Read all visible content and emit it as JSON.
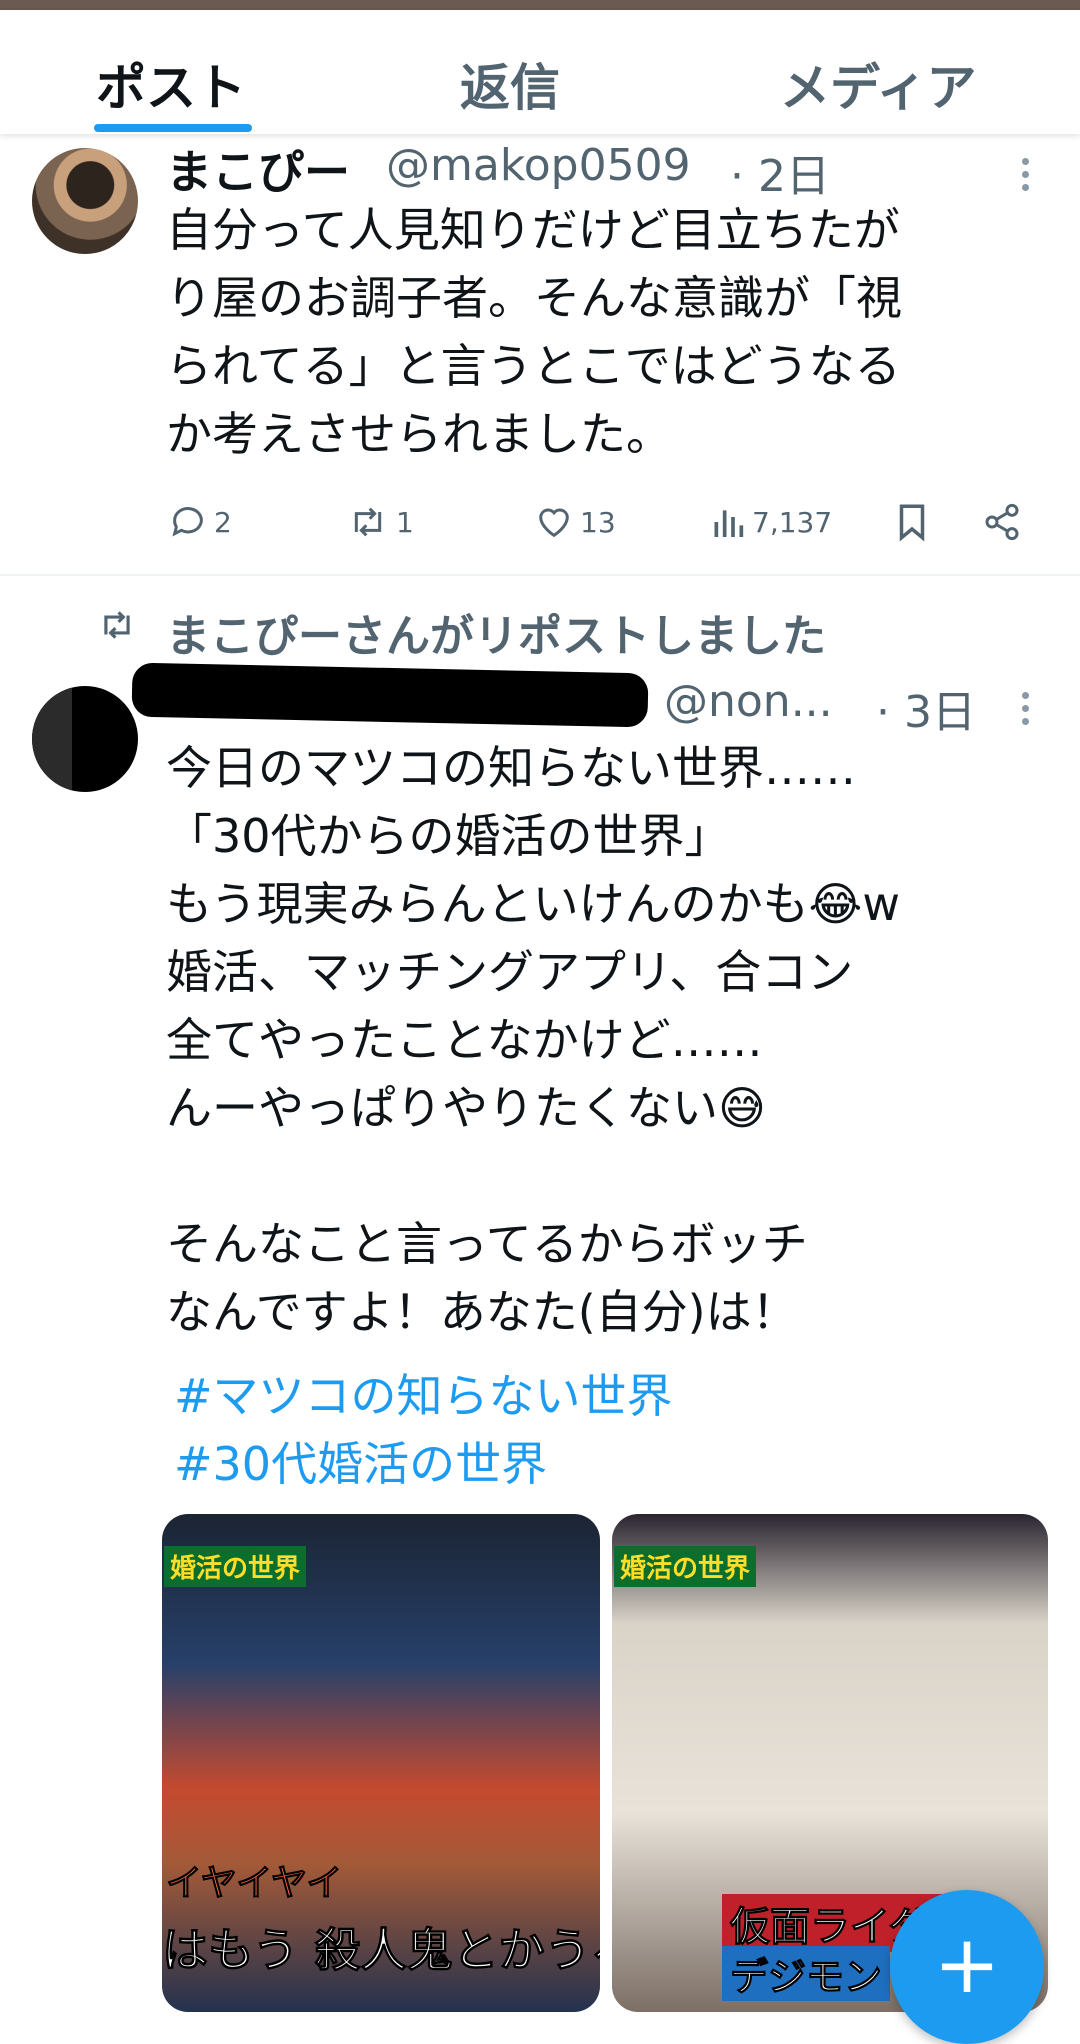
{
  "tabs": [
    {
      "label": "ポスト",
      "active": true
    },
    {
      "label": "返信",
      "active": false
    },
    {
      "label": "メディア",
      "active": false
    }
  ],
  "post1": {
    "name": "まこぴー",
    "handle": "@makop0509",
    "time": "· 2日",
    "lines": [
      "自分って人見知りだけど目立ちたが",
      "り屋のお調子者。そんな意識が「視",
      "られてる」と言うとこではどうなる",
      "か考えさせられました。"
    ],
    "actions": {
      "replies": "2",
      "reposts": "1",
      "likes": "13",
      "views": "7,137"
    }
  },
  "repost_banner": "まこぴーさんがリポストしました",
  "post2": {
    "handle": "@non...",
    "time": "· 3日",
    "lines": [
      "今日のマツコの知らない世界……",
      "「30代からの婚活の世界」",
      "もう現実みらんといけんのかも😂w",
      "婚活、マッチングアプリ、合コン",
      "全てやったことなかけど……",
      "んーやっぱりやりたくない😅",
      "",
      "そんなこと言ってるからボッチ",
      "なんですよ！あなた(自分)は！"
    ],
    "hashtags": [
      "#マツコの知らない世界",
      "#30代婚活の世界"
    ],
    "media": {
      "left": {
        "label": "婚活の世界",
        "caption": "はもう 殺人鬼とかうろ",
        "sub": "イヤイヤイ"
      },
      "right": {
        "label": "婚活の世界",
        "caption": "仮面ライダー",
        "sub": "デジモン"
      }
    }
  },
  "fab_symbol": "+",
  "colors": {
    "accent": "#1d9bf0",
    "text": "#0f1419",
    "muted": "#536471"
  }
}
